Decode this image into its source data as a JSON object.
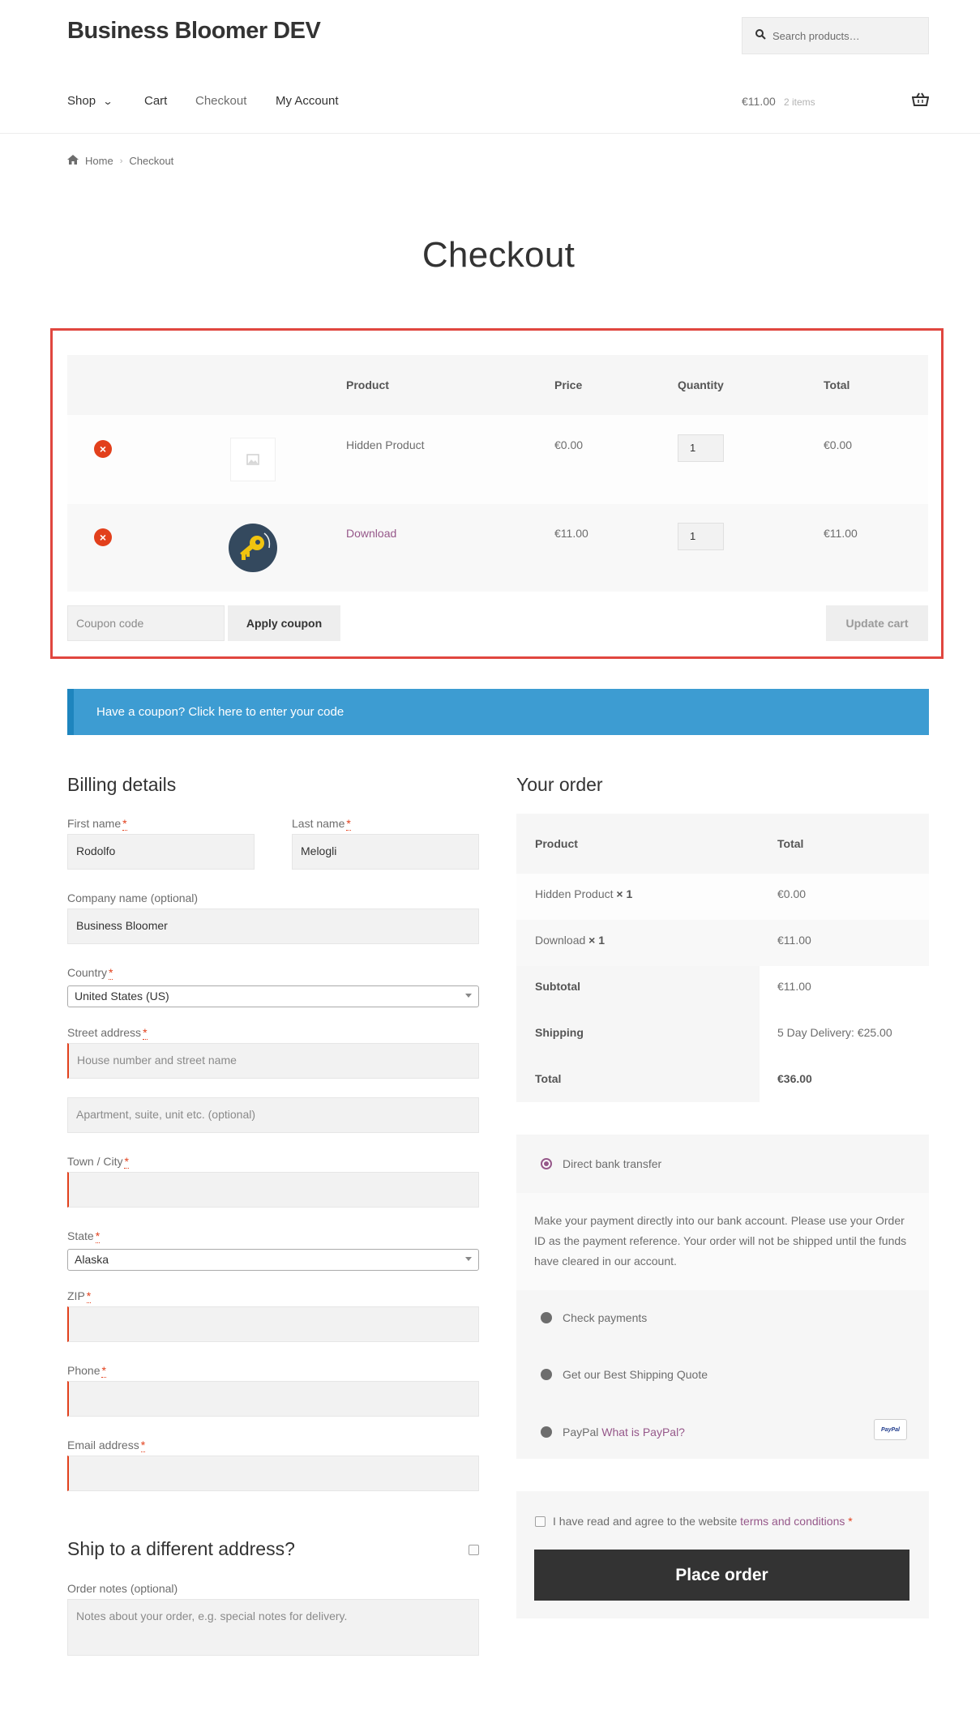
{
  "site": {
    "title": "Business Bloomer DEV",
    "search_placeholder": "Search products…"
  },
  "nav": {
    "shop": "Shop",
    "cart": "Cart",
    "checkout": "Checkout",
    "my_account": "My Account"
  },
  "header_cart": {
    "amount": "€11.00",
    "items": "2 items"
  },
  "breadcrumb": {
    "home": "Home",
    "current": "Checkout"
  },
  "page_title": "Checkout",
  "cart": {
    "headers": {
      "product": "Product",
      "price": "Price",
      "quantity": "Quantity",
      "total": "Total"
    },
    "rows": [
      {
        "product": "Hidden Product",
        "price": "€0.00",
        "quantity": "1",
        "total": "€0.00"
      },
      {
        "product": "Download",
        "price": "€11.00",
        "quantity": "1",
        "total": "€11.00"
      }
    ],
    "coupon_placeholder": "Coupon code",
    "apply_coupon": "Apply coupon",
    "update_cart": "Update cart"
  },
  "notice": "Have a coupon? Click here to enter your code",
  "billing": {
    "heading": "Billing details",
    "first_name_label": "First name",
    "first_name": "Rodolfo",
    "last_name_label": "Last name",
    "last_name": "Melogli",
    "company_label": "Company name (optional)",
    "company": "Business Bloomer",
    "country_label": "Country",
    "country": "United States (US)",
    "street_label": "Street address",
    "street_placeholder": "House number and street name",
    "apartment_placeholder": "Apartment, suite, unit etc. (optional)",
    "city_label": "Town / City",
    "state_label": "State",
    "state": "Alaska",
    "zip_label": "ZIP",
    "phone_label": "Phone",
    "email_label": "Email address",
    "required_mark": "*"
  },
  "shipping": {
    "heading": "Ship to a different address?",
    "notes_label": "Order notes (optional)",
    "notes_placeholder": "Notes about your order, e.g. special notes for delivery."
  },
  "order": {
    "heading": "Your order",
    "headers": {
      "product": "Product",
      "total": "Total"
    },
    "items": [
      {
        "name": "Hidden Product",
        "qty": "× 1",
        "total": "€0.00"
      },
      {
        "name": "Download",
        "qty": "× 1",
        "total": "€11.00"
      }
    ],
    "subtotal_label": "Subtotal",
    "subtotal": "€11.00",
    "shipping_label": "Shipping",
    "shipping": "5 Day Delivery: €25.00",
    "total_label": "Total",
    "total": "€36.00"
  },
  "payment": {
    "methods": [
      {
        "label": "Direct bank transfer",
        "selected": true
      },
      {
        "label": "Check payments",
        "selected": false
      },
      {
        "label": "Get our Best Shipping Quote",
        "selected": false
      },
      {
        "label": "PayPal",
        "selected": false
      }
    ],
    "bank_description": "Make your payment directly into our bank account. Please use your Order ID as the payment reference. Your order will not be shipped until the funds have cleared in our account.",
    "paypal_link": "What is PayPal?",
    "paypal_badge": "PayPal"
  },
  "terms": {
    "text": "I have read and agree to the website",
    "link": "terms and conditions",
    "required": "*"
  },
  "place_order": "Place order",
  "colors": {
    "accent": "#96588a",
    "notice_blue": "#3d9cd2",
    "error_red": "#e2401c",
    "dark_button": "#333333"
  }
}
